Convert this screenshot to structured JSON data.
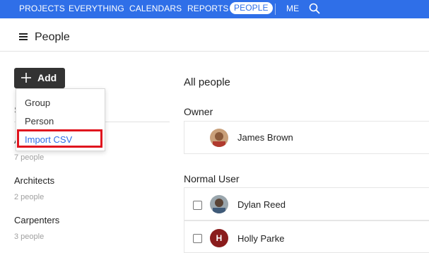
{
  "topnav": {
    "items": [
      "PROJECTS",
      "EVERYTHING",
      "CALENDARS",
      "REPORTS",
      "PEOPLE",
      "ME"
    ],
    "active": "PEOPLE",
    "bg_color": "#2f6fe8"
  },
  "header": {
    "title": "People"
  },
  "add_button": {
    "label": "Add"
  },
  "dropdown": {
    "items": [
      "Group",
      "Person",
      "Import CSV"
    ],
    "highlight_color": "#e0141e"
  },
  "groups": [
    {
      "name": "Architects",
      "count": "2 people"
    },
    {
      "name": "Carpenters",
      "count": "3 people"
    }
  ],
  "group_partial": {
    "letter_s": "S",
    "letter_a": "A",
    "count": "7 people"
  },
  "main": {
    "title": "All people",
    "owner_label": "Owner",
    "owner": {
      "name": "James Brown"
    },
    "normal_label": "Normal User",
    "normal_users": [
      {
        "name": "Dylan Reed"
      },
      {
        "name": "Holly Parke",
        "initial": "H",
        "avatar_color": "#8a1c1c"
      }
    ]
  }
}
